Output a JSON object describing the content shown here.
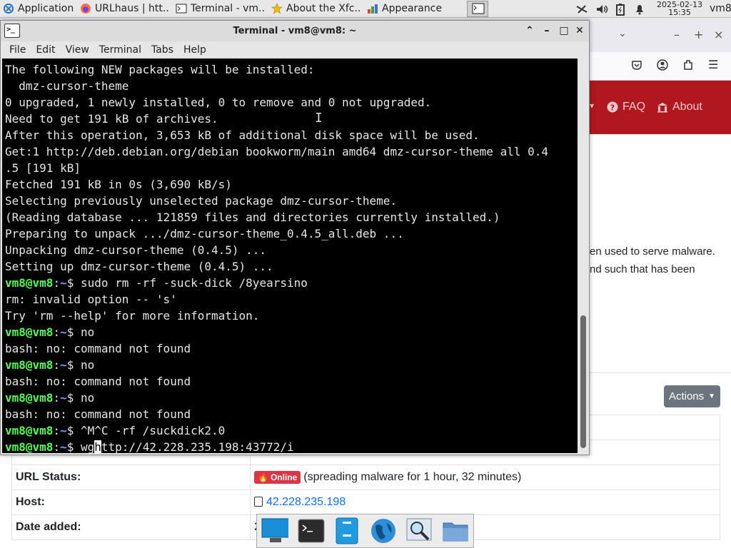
{
  "panel": {
    "tasks": [
      {
        "label": "Applications ≡",
        "icon": "xfce-menu-icon"
      },
      {
        "label": "URLhaus | htt...",
        "icon": "firefox-icon"
      },
      {
        "label": "Terminal - vm...",
        "icon": "terminal-icon"
      },
      {
        "label": "About the Xfc...",
        "icon": "star-icon"
      },
      {
        "label": "Appearance",
        "icon": "appearance-icon"
      }
    ],
    "clock_date": "2025-02-13",
    "clock_time": "15:35",
    "user": "vm8"
  },
  "browser": {
    "nav": {
      "faq": "FAQ",
      "about": "About"
    },
    "text1": "en used to serve malware.",
    "text2": "nd such that has been",
    "actions_label": "Actions",
    "table": [
      {
        "key": "",
        "value": ""
      },
      {
        "key": "",
        "value": ""
      },
      {
        "key": "URL Status:",
        "badge": "Online",
        "value": "(spreading malware for 1 hour, 32 minutes)"
      },
      {
        "key": "Host:",
        "value": "42.228.235.198"
      },
      {
        "key": "Date added:",
        "value": "2"
      }
    ]
  },
  "terminal": {
    "title": "Terminal - vm8@vm8: ~",
    "menu": [
      "File",
      "Edit",
      "View",
      "Terminal",
      "Tabs",
      "Help"
    ],
    "prompt_user": "vm8@vm8",
    "lines": [
      {
        "kind": "out",
        "text": "The following NEW packages will be installed:"
      },
      {
        "kind": "out",
        "text": "  dmz-cursor-theme"
      },
      {
        "kind": "out",
        "text": "0 upgraded, 1 newly installed, 0 to remove and 0 not upgraded."
      },
      {
        "kind": "out",
        "text": "Need to get 191 kB of archives."
      },
      {
        "kind": "out",
        "text": "After this operation, 3,653 kB of additional disk space will be used."
      },
      {
        "kind": "out",
        "text": "Get:1 http://deb.debian.org/debian bookworm/main amd64 dmz-cursor-theme all 0.4"
      },
      {
        "kind": "out",
        "text": ".5 [191 kB]"
      },
      {
        "kind": "out",
        "text": "Fetched 191 kB in 0s (3,690 kB/s)"
      },
      {
        "kind": "out",
        "text": "Selecting previously unselected package dmz-cursor-theme."
      },
      {
        "kind": "out",
        "text": "(Reading database ... 121859 files and directories currently installed.)"
      },
      {
        "kind": "out",
        "text": "Preparing to unpack .../dmz-cursor-theme_0.4.5_all.deb ..."
      },
      {
        "kind": "out",
        "text": "Unpacking dmz-cursor-theme (0.4.5) ..."
      },
      {
        "kind": "out",
        "text": "Setting up dmz-cursor-theme (0.4.5) ..."
      },
      {
        "kind": "cmd",
        "text": "sudo rm -rf -suck-dick /8yearsino"
      },
      {
        "kind": "out",
        "text": "rm: invalid option -- 's'"
      },
      {
        "kind": "out",
        "text": "Try 'rm --help' for more information."
      },
      {
        "kind": "cmd",
        "text": "no"
      },
      {
        "kind": "out",
        "text": "bash: no: command not found"
      },
      {
        "kind": "cmd",
        "text": "no"
      },
      {
        "kind": "out",
        "text": "bash: no: command not found"
      },
      {
        "kind": "cmd",
        "text": "no"
      },
      {
        "kind": "out",
        "text": "bash: no: command not found"
      },
      {
        "kind": "cmd",
        "text": "^M^C -rf /suckdick2.0"
      },
      {
        "kind": "cmd_cursor",
        "before": "wg",
        "cursor": "h",
        "after": "ttp://42.228.235.198:43772/i"
      }
    ]
  },
  "dock": [
    "show-desktop-icon",
    "terminal-icon",
    "file-manager-icon",
    "web-browser-icon",
    "app-finder-icon",
    "folder-icon"
  ]
}
